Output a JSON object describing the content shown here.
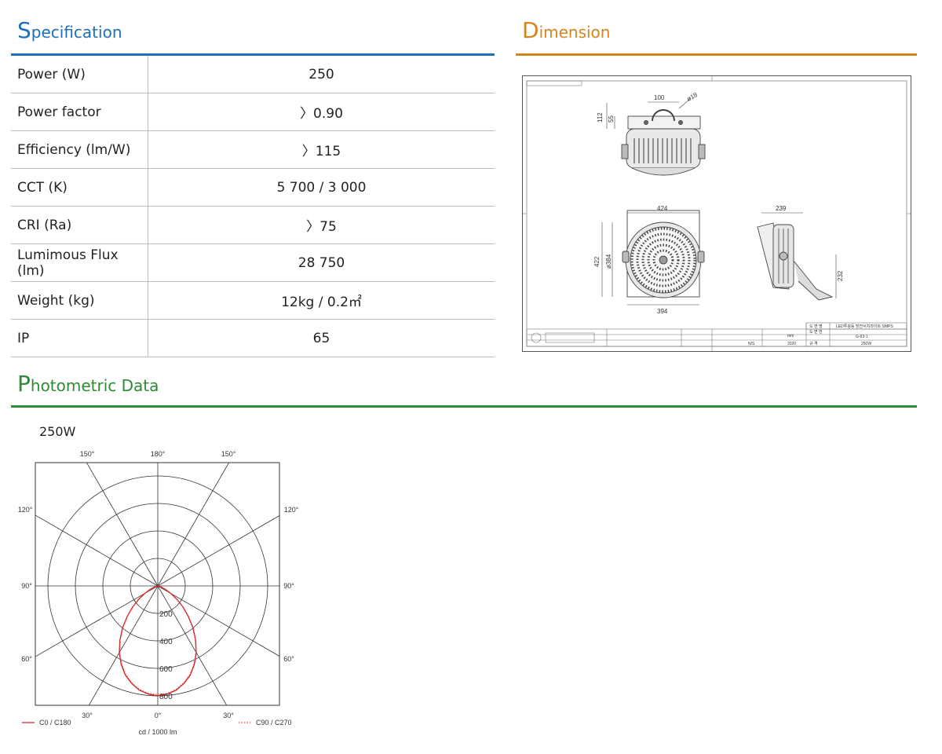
{
  "sections": {
    "specification": {
      "cap": "S",
      "rest": "pecification"
    },
    "dimension": {
      "cap": "D",
      "rest": "imension"
    },
    "photometric": {
      "cap": "P",
      "rest": "hotometric Data"
    }
  },
  "colors": {
    "spec_accent": "#1d6fb8",
    "dim_accent": "#d6841e",
    "photo_accent": "#2d8a35",
    "curve_c0": "#d11a1a",
    "curve_c90": "#e05050"
  },
  "spec_rows": [
    {
      "label": "Power (W)",
      "value": "250"
    },
    {
      "label": "Power factor",
      "value": "〉0.90"
    },
    {
      "label": "Efficiency (lm/W)",
      "value": "〉115"
    },
    {
      "label": "CCT (K)",
      "value": "5 700 / 3 000"
    },
    {
      "label": "CRI (Ra)",
      "value": "〉75"
    },
    {
      "label": "Lumimous Flux (lm)",
      "value": "28 750"
    },
    {
      "label": "Weight (kg)",
      "value": "12kg / 0.2㎡"
    },
    {
      "label": "IP",
      "value": "65"
    }
  ],
  "dimension": {
    "top_view": {
      "width": "100",
      "hole": "ø18",
      "height_total": "112",
      "height_bracket": "55"
    },
    "front_view": {
      "width": "424",
      "diameter": "ø384",
      "height": "422",
      "base": "394"
    },
    "side_view": {
      "depth": "239",
      "height": "232"
    },
    "title_block": {
      "product": "LED투광등 방전서치라이트 SMPS",
      "code": "G-63-1",
      "power": "250W",
      "scale": "N/S",
      "unit": "mm",
      "year": "2020",
      "row_labels": [
        "도 면 명",
        "도 면 번",
        "규 격"
      ]
    }
  },
  "chart_data": {
    "type": "polar",
    "title": "250W",
    "angle_labels": {
      "top": [
        "150°",
        "180°",
        "150°"
      ],
      "left": [
        "120°",
        "90°",
        "60°"
      ],
      "right": [
        "120°",
        "90°",
        "60°"
      ],
      "bottom": [
        "30°",
        "0°",
        "30°"
      ]
    },
    "radial_ticks": [
      200,
      400,
      600,
      800
    ],
    "rmax": 800,
    "unit_label": "cd / 1000 lm",
    "series": [
      {
        "name": "C0 / C180",
        "style": "solid",
        "angles_deg": [
          0,
          5,
          10,
          15,
          20,
          25,
          30,
          35,
          40,
          45,
          50,
          55,
          60,
          65,
          70,
          80,
          90
        ],
        "values": [
          800,
          790,
          770,
          735,
          690,
          630,
          560,
          480,
          400,
          315,
          240,
          170,
          110,
          65,
          35,
          8,
          0
        ]
      },
      {
        "name": "C90 / C270",
        "style": "dotted",
        "angles_deg": [
          0,
          5,
          10,
          15,
          20,
          25,
          30,
          35,
          40,
          45,
          50,
          55,
          60,
          65,
          70,
          80,
          90
        ],
        "values": [
          790,
          785,
          765,
          730,
          685,
          625,
          555,
          475,
          395,
          310,
          235,
          165,
          105,
          60,
          32,
          7,
          0
        ]
      }
    ]
  }
}
